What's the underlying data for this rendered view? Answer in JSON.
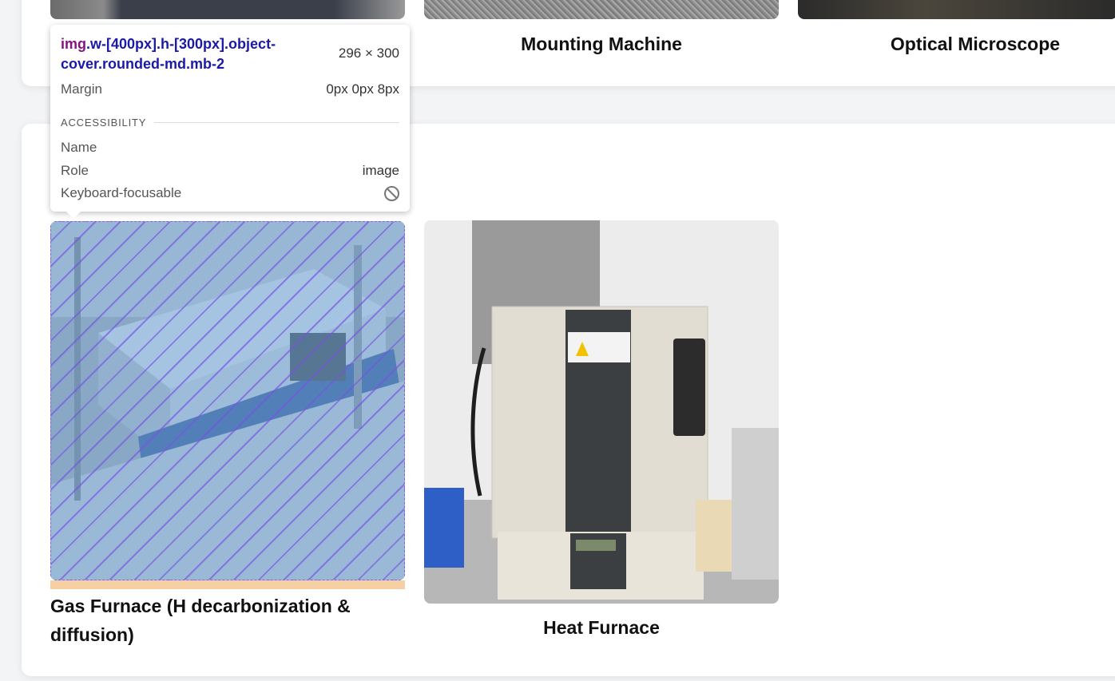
{
  "cards_top": {
    "captions": [
      "Mounting Machine",
      "Optical Microscope"
    ]
  },
  "cards_bottom": {
    "items": [
      {
        "caption": "Gas Furnace (H decarbonization & diffusion)",
        "alt": ""
      },
      {
        "caption": "Heat Furnace",
        "alt": ""
      }
    ]
  },
  "inspector_tooltip": {
    "tag": "img",
    "classes": ".w-[400px].h-[300px].object-cover.rounded-md.mb-2",
    "size": "296 × 300",
    "margin_label": "Margin",
    "margin_value": "0px 0px 8px",
    "section_title": "ACCESSIBILITY",
    "name_label": "Name",
    "name_value": "",
    "role_label": "Role",
    "role_value": "image",
    "focus_label": "Keyboard-focusable",
    "focus_icon": "not-allowed-icon"
  },
  "colors": {
    "highlight_fill": "#6fa8dc",
    "highlight_hatch": "#7850e6",
    "margin_box": "#f6cfa3",
    "selector_class": "#1a1aa6",
    "selector_tag": "#881280"
  }
}
